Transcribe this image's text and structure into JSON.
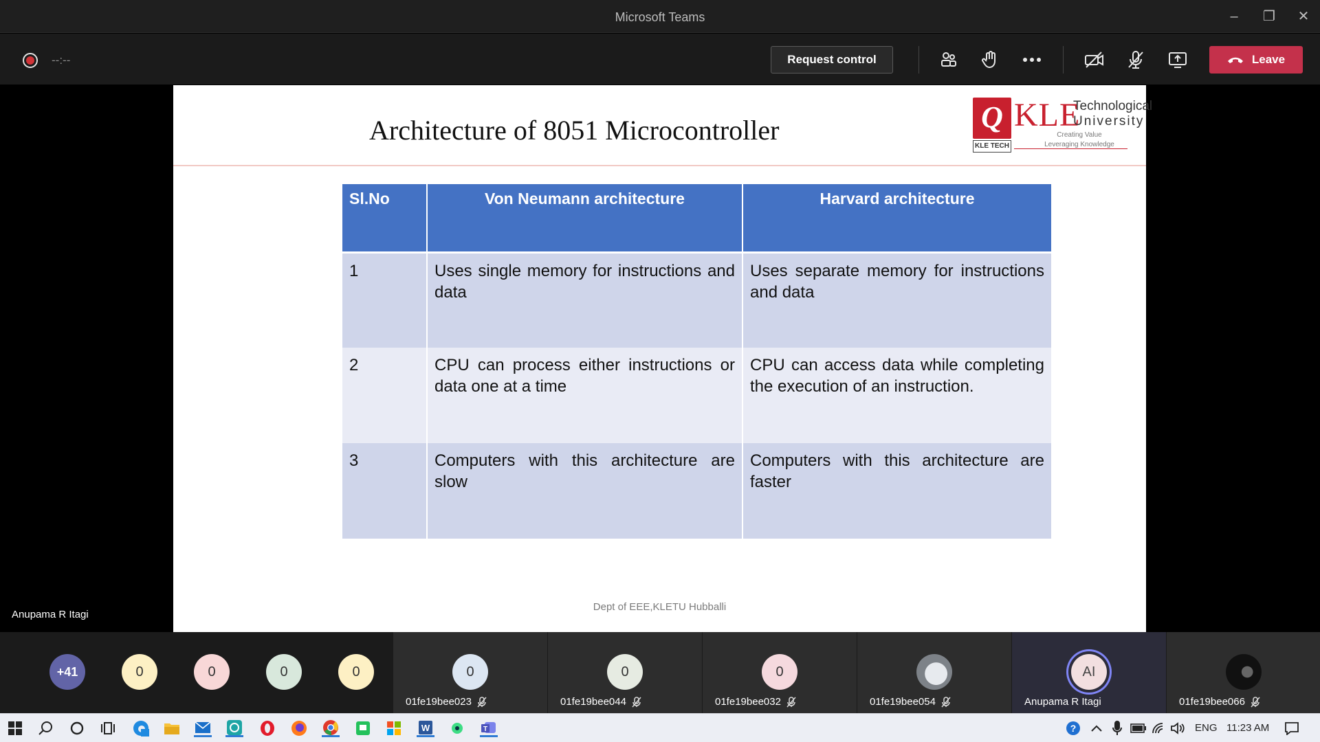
{
  "window": {
    "title": "Microsoft Teams"
  },
  "toolbar": {
    "timer": "--:--",
    "request_control_label": "Request control",
    "leave_label": "Leave",
    "colors": {
      "leave": "#c4314b",
      "record": "#d13438"
    }
  },
  "slide": {
    "title": "Architecture of 8051 Microcontroller",
    "logo": {
      "mark": "Q",
      "kle": "KLE",
      "tech_line1": "Technological",
      "tech_line2": "University",
      "tag_line1": "Creating Value",
      "tag_line2": "Leveraging Knowledge",
      "sub": "KLE TECH"
    },
    "table": {
      "headers": [
        "Sl.No",
        "Von Neumann architecture",
        "Harvard architecture"
      ],
      "rows": [
        [
          "1",
          "Uses single memory for instructions and data",
          "Uses separate memory for instructions and data"
        ],
        [
          "2",
          "CPU can process either instructions or data one at a time",
          "CPU can access data while completing the execution of an instruction."
        ],
        [
          "3",
          "Computers with this architecture are slow",
          "Computers with this architecture are faster"
        ]
      ],
      "colors": {
        "header": "#4472c4",
        "row_dark": "#cfd5ea",
        "row_light": "#e9ebf5"
      }
    },
    "footer": "Dept of EEE,KLETU  Hubballi"
  },
  "presenter_name": "Anupama R Itagi",
  "participants": {
    "overflow": "+41",
    "bubbles": [
      {
        "initials": "0",
        "color": "#fdf0c4"
      },
      {
        "initials": "0",
        "color": "#f8d7d7"
      },
      {
        "initials": "0",
        "color": "#d8e8dc"
      },
      {
        "initials": "0",
        "color": "#fdf0c4"
      }
    ],
    "tiles": [
      {
        "name": "01fe19bee023",
        "initials": "0",
        "color": "#dce6f2"
      },
      {
        "name": "01fe19bee044",
        "initials": "0",
        "color": "#e6ebe2"
      },
      {
        "name": "01fe19bee032",
        "initials": "0",
        "color": "#f5d9de"
      },
      {
        "name": "01fe19bee054",
        "initials": "",
        "color": "#bfc3c8"
      },
      {
        "name": "Anupama R Itagi",
        "initials": "AI",
        "color": "#f2dfe0"
      },
      {
        "name": "01fe19bee066",
        "initials": "",
        "color": "#222222"
      }
    ]
  },
  "taskbar": {
    "language": "ENG",
    "time": "11:23 AM"
  }
}
